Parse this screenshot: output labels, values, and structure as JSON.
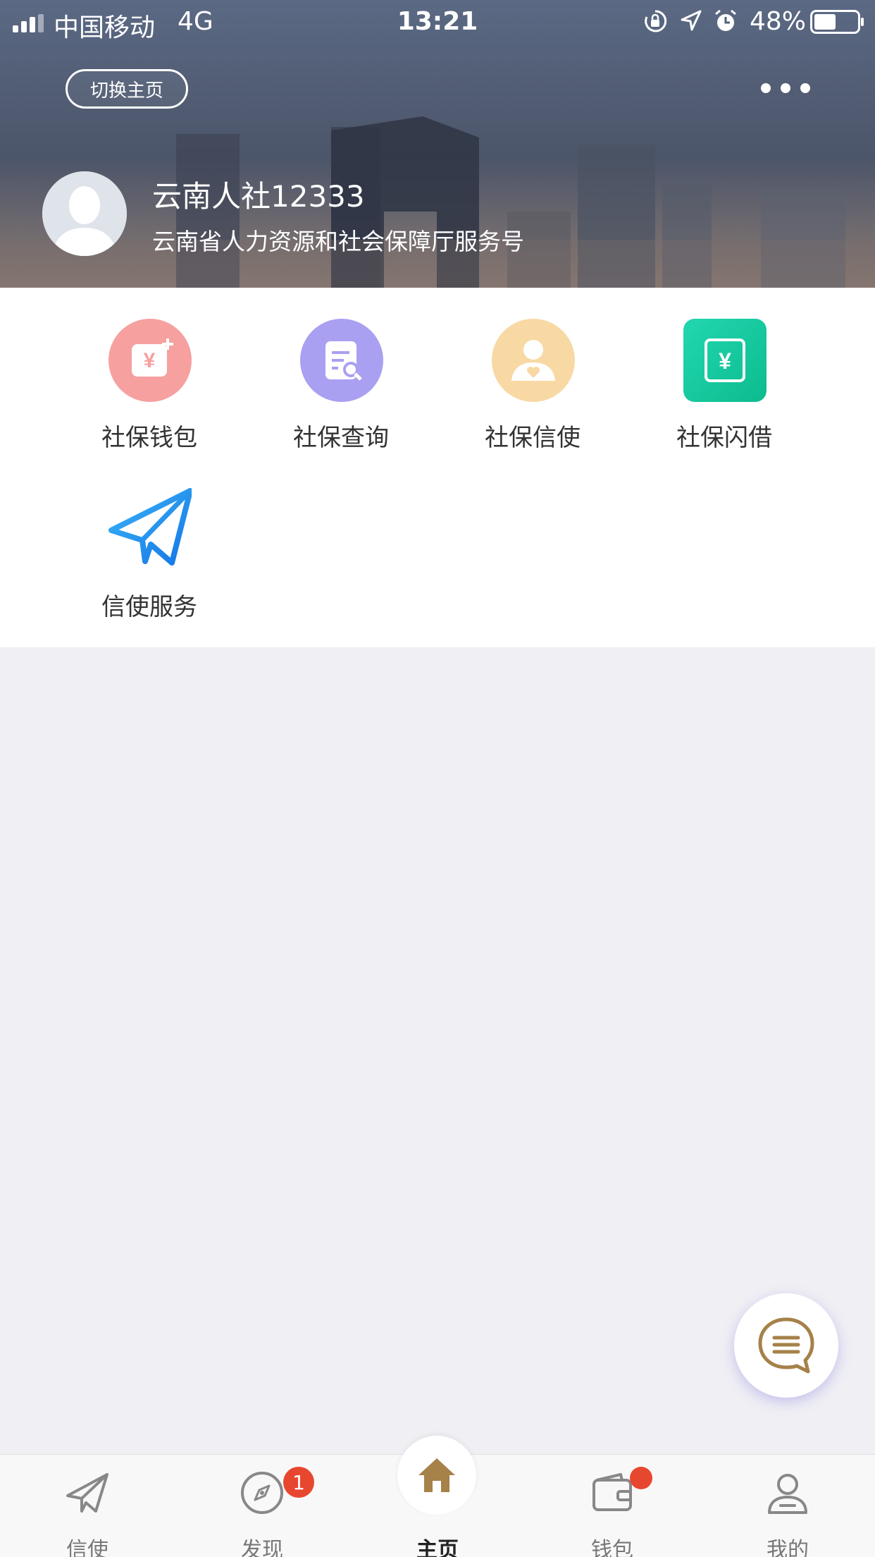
{
  "status_bar": {
    "carrier": "中国移动",
    "network": "4G",
    "time": "13:21",
    "battery": "48%",
    "battery_level": 0.48
  },
  "header": {
    "switch_label": "切换主页",
    "more_icon": "more-dots-icon",
    "account_name": "云南人社12333",
    "account_desc": "云南省人力资源和社会保障厅服务号"
  },
  "menu": {
    "items": [
      {
        "label": "社保钱包",
        "icon": "wallet-yen-icon",
        "color": "#f6a0a0"
      },
      {
        "label": "社保查询",
        "icon": "document-search-icon",
        "color": "#a9a0f2"
      },
      {
        "label": "社保信使",
        "icon": "person-heart-icon",
        "color": "#f8d9a4"
      },
      {
        "label": "社保闪借",
        "icon": "yen-card-icon",
        "color": "#1ec9a0"
      },
      {
        "label": "信使服务",
        "icon": "paper-plane-icon",
        "color": "#1e8ff2"
      }
    ]
  },
  "fab": {
    "icon": "chat-bubble-icon",
    "color": "#a68148"
  },
  "tabbar": {
    "items": [
      {
        "label": "信使",
        "icon": "paper-plane-icon"
      },
      {
        "label": "发现",
        "icon": "compass-icon",
        "badge": "1"
      },
      {
        "label": "主页",
        "icon": "home-icon",
        "active": true
      },
      {
        "label": "钱包",
        "icon": "wallet-icon",
        "dot": true
      },
      {
        "label": "我的",
        "icon": "user-icon"
      }
    ]
  },
  "colors": {
    "accent": "#a68148",
    "badge": "#e8472f",
    "background": "#efeff4"
  }
}
